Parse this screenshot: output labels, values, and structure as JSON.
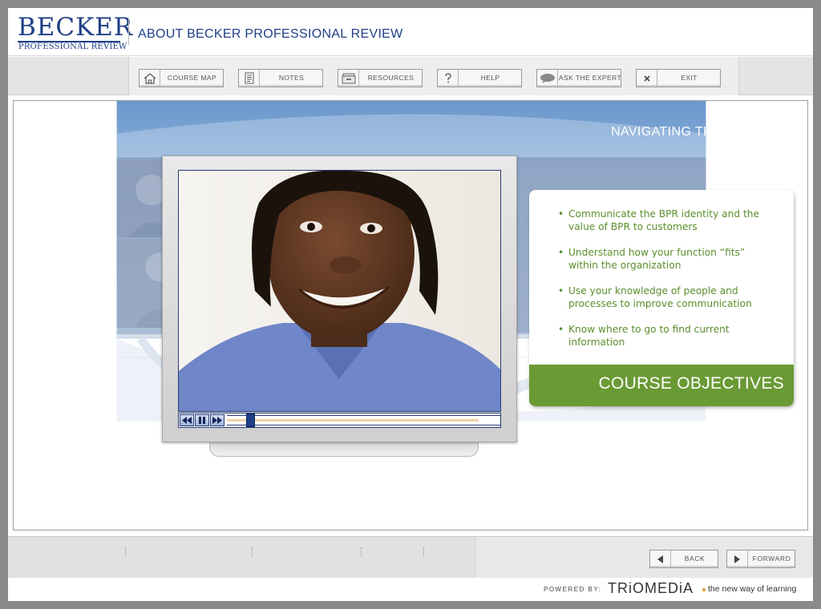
{
  "header": {
    "logo_main": "BECKER",
    "logo_sub": "PROFESSIONAL REVIEW",
    "title": "ABOUT BECKER PROFESSIONAL REVIEW"
  },
  "toolbar": {
    "buttons": [
      {
        "label": "COURSE MAP",
        "icon": "home-icon"
      },
      {
        "label": "NOTES",
        "icon": "notes-icon"
      },
      {
        "label": "RESOURCES",
        "icon": "resources-icon"
      },
      {
        "label": "HELP",
        "icon": "help-icon"
      },
      {
        "label": "ASK THE EXPERT",
        "icon": "speech-bubble-icon"
      },
      {
        "label": "EXIT",
        "icon": "close-icon"
      }
    ]
  },
  "stage": {
    "title": "NAVIGATING THE COURSE",
    "video": {
      "progress_fraction": 0.92,
      "playhead_fraction": 0.07
    },
    "objectives": {
      "items": [
        {
          "bullet": "•",
          "text": "Communicate the BPR identity and the value of BPR to customers"
        },
        {
          "bullet": "•",
          "text": "Understand how your function “fits” within the organization"
        },
        {
          "bullet": "•",
          "text": "Use your knowledge of people and processes to improve communication"
        },
        {
          "bullet": "•",
          "text": "Know where to go to find current information"
        }
      ],
      "banner": "COURSE OBJECTIVES"
    }
  },
  "nav": {
    "back_label": "BACK",
    "forward_label": "FORWARD"
  },
  "footer": {
    "powered_by": "POWERED BY:",
    "brand": "TRiOMEDiA",
    "tagline": "the new way of learning"
  },
  "colors": {
    "brand_blue": "#1f3f86",
    "objective_green": "#6a9a34",
    "sky_blue": "#6f9cd0"
  }
}
